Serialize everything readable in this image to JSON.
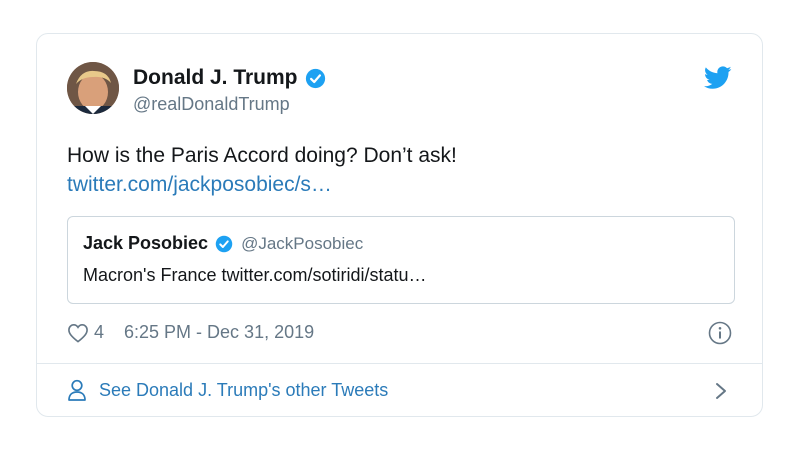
{
  "tweet": {
    "author_name": "Donald J. Trump",
    "author_handle": "@realDonaldTrump",
    "text": "How is the Paris Accord doing? Don’t ask!",
    "link": "twitter.com/jackposobiec/s…",
    "likes": "4",
    "timestamp": "6:25 PM - Dec 31, 2019"
  },
  "quoted": {
    "author_name": "Jack Posobiec",
    "author_handle": "@JackPosobiec",
    "text": "Macron's France twitter.com/sotiridi/statu…"
  },
  "footer": {
    "label": "See Donald J. Trump's other Tweets"
  },
  "icons": {
    "verified": "verified-badge-icon",
    "bird": "twitter-bird-icon",
    "heart": "heart-icon",
    "info": "info-icon",
    "person": "person-icon",
    "chevron": "chevron-right-icon"
  },
  "colors": {
    "link": "#2b7bb9",
    "verified": "#1da1f2",
    "secondary_text": "#657786",
    "border": "#e1e8ed"
  }
}
